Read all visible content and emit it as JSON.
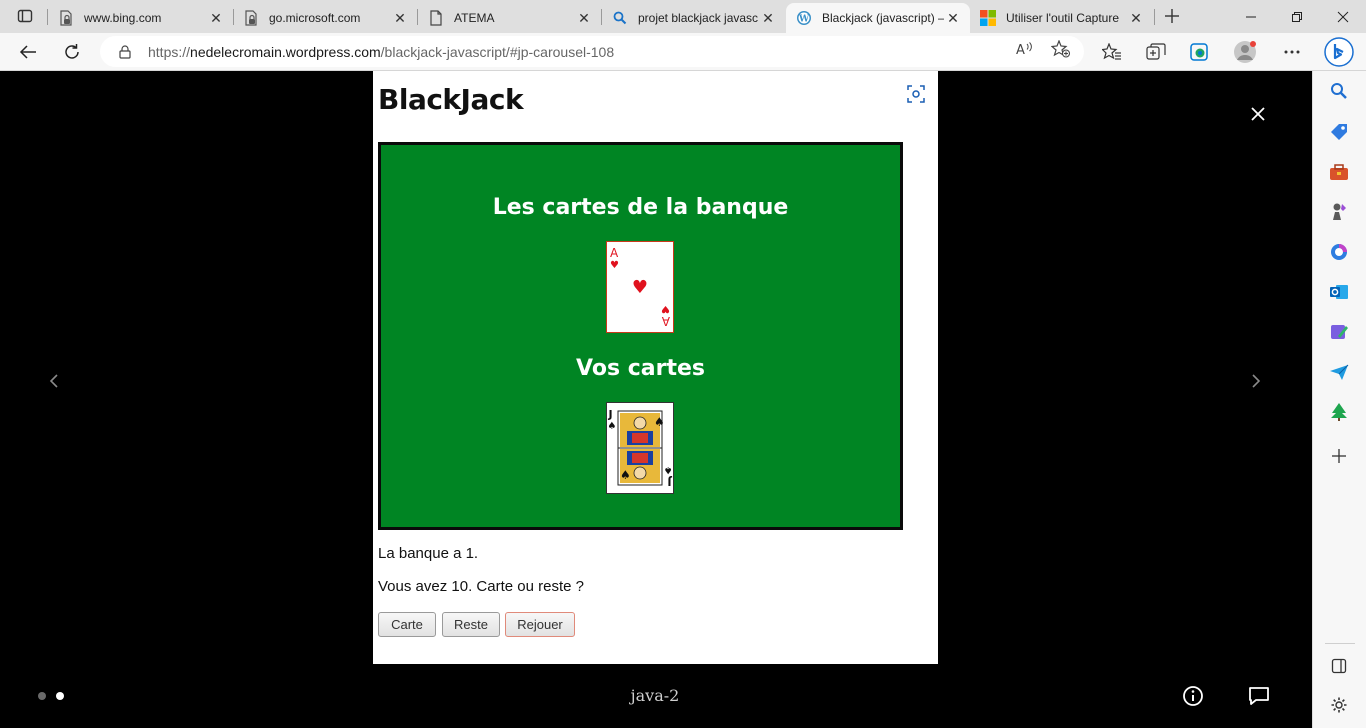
{
  "browser": {
    "tabs": [
      {
        "label": "www.bing.com",
        "icon": "page-lock-icon"
      },
      {
        "label": "go.microsoft.com",
        "icon": "page-lock-icon"
      },
      {
        "label": "ATEMA",
        "icon": "page-icon"
      },
      {
        "label": "projet blackjack javasc",
        "icon": "search-icon"
      },
      {
        "label": "Blackjack (javascript) –",
        "icon": "wordpress-icon",
        "active": true
      },
      {
        "label": "Utiliser l'outil Capture",
        "icon": "microsoft-logo-icon"
      }
    ],
    "address": {
      "prefix": "https://",
      "host": "nedelecromain.wordpress.com",
      "path": "/blackjack-javascript/#jp-carousel-108"
    }
  },
  "slide": {
    "title": "BlackJack",
    "bank_heading": "Les cartes de la banque",
    "player_heading": "Vos cartes",
    "bank_card": {
      "rank": "A",
      "suit": "♥",
      "color": "#e0121e"
    },
    "player_card": {
      "rank": "J",
      "suit": "♠",
      "color": "#111111"
    },
    "bank_status": "La banque a 1.",
    "player_status": "Vous avez 10. Carte ou reste ?",
    "buttons": {
      "hit": "Carte",
      "stand": "Reste",
      "replay": "Rejouer"
    },
    "table_color": "#008523"
  },
  "carousel": {
    "caption": "java-2",
    "dots": 2,
    "active_dot": 2
  }
}
